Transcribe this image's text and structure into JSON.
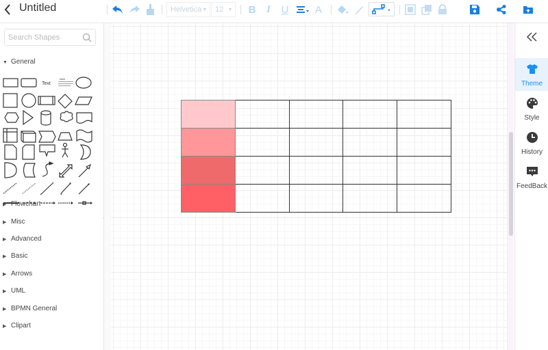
{
  "header": {
    "title": "Untitled",
    "font_family": "Helvetica",
    "font_size": "12",
    "bold_label": "B",
    "italic_label": "I",
    "underline_label": "U",
    "font_color_label": "A",
    "icons": [
      "back-icon",
      "undo-icon",
      "redo-icon",
      "format-painter-icon",
      "bold-icon",
      "italic-icon",
      "underline-icon",
      "align-icon",
      "font-color-icon",
      "fill-icon",
      "line-color-icon",
      "connector-style-icon",
      "bring-front-icon",
      "send-back-icon",
      "lock-icon",
      "save-icon",
      "share-icon",
      "export-icon"
    ]
  },
  "sidebar": {
    "search_placeholder": "Search Shapes",
    "general_label": "General",
    "general_expanded": true,
    "text_shape_label": "Text",
    "categories": [
      {
        "label": "Flowchart"
      },
      {
        "label": "Misc"
      },
      {
        "label": "Advanced"
      },
      {
        "label": "Basic"
      },
      {
        "label": "Arrows"
      },
      {
        "label": "UML"
      },
      {
        "label": "BPMN General"
      },
      {
        "label": "Clipart"
      }
    ]
  },
  "canvas": {
    "table": {
      "rows": 4,
      "cols": 5,
      "first_column_fills": [
        "#ffc9cc",
        "#ff9699",
        "#ee6a6b",
        "#ff6066"
      ]
    }
  },
  "right_panel": {
    "collapse_label": "«",
    "items": [
      {
        "label": "Theme",
        "active": true
      },
      {
        "label": "Style",
        "active": false
      },
      {
        "label": "History",
        "active": false
      },
      {
        "label": "FeedBack",
        "active": false
      }
    ]
  },
  "colors": {
    "accent": "#1a8ff0",
    "disabled": "#b5d6f5"
  }
}
